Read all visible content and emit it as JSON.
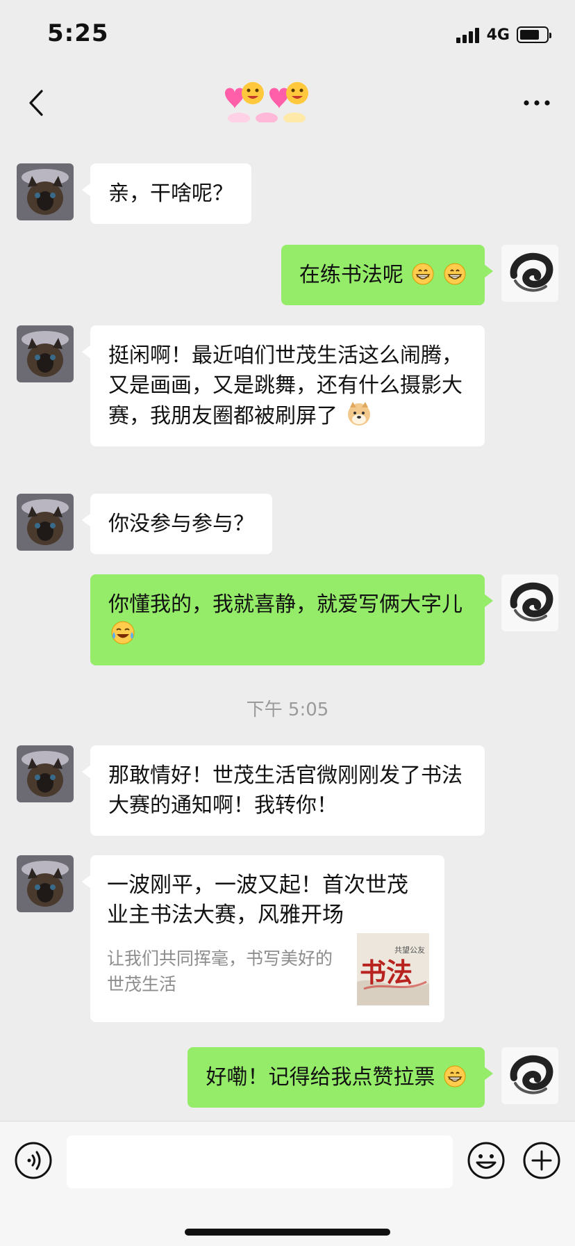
{
  "status_bar": {
    "time": "5:25",
    "network": "4G",
    "battery_level": 0.75
  },
  "nav": {
    "title_icon": "emoji-heart-sticker-icon"
  },
  "messages": [
    {
      "side": "in",
      "text": "亲，干啥呢？"
    },
    {
      "side": "out",
      "text": "在练书法呢",
      "emojis": [
        "grin-emoji",
        "grin-emoji"
      ]
    },
    {
      "side": "in",
      "text": "挺闲啊！最近咱们世茂生活这么闹腾，又是画画，又是跳舞，还有什么摄影大赛，我朋友圈都被刷屏了",
      "emojis": [
        "doge-emoji"
      ]
    },
    {
      "side": "in",
      "text": "你没参与参与？"
    },
    {
      "side": "out",
      "text": "你懂我的，我就喜静，就爱写俩大字儿",
      "emojis": [
        "laugh-cry-emoji"
      ]
    },
    {
      "side": "in",
      "text": "那敢情好！世茂生活官微刚刚发了书法大赛的通知啊！我转你！"
    },
    {
      "side": "in",
      "card": {
        "title": "一波刚平，一波又起！首次世茂业主书法大赛，风雅开场",
        "desc": "让我们共同挥毫，书写美好的世茂生活",
        "thumb_text": "书法",
        "thumb_caption": "共望公友"
      }
    },
    {
      "side": "out",
      "text": "好嘞！记得给我点赞拉票",
      "emojis": [
        "grin-emoji"
      ]
    }
  ],
  "time_divider": "下午 5:05",
  "input": {
    "value": "",
    "placeholder": ""
  },
  "colors": {
    "background": "#ededed",
    "incoming_bubble": "#ffffff",
    "outgoing_bubble": "#95ec69"
  }
}
